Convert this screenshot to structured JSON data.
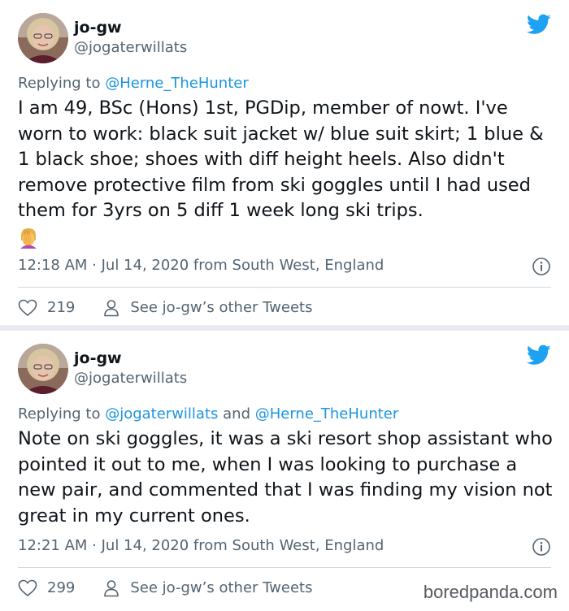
{
  "colors": {
    "link": "#1b95e0",
    "muted": "#536471",
    "text": "#0f1419",
    "twitter_blue": "#1da1f2"
  },
  "tweets": [
    {
      "display_name": "jo-gw",
      "handle": "@jogaterwillats",
      "replying_prefix": "Replying to ",
      "mentions": [
        "@Herne_TheHunter"
      ],
      "mention_joiner": "",
      "body": "I am 49, BSc (Hons) 1st, PGDip, member of nowt. I've worn to work: black suit jacket w/ blue suit skirt; 1 blue & 1 black shoe; shoes with diff height heels. Also didn't remove protective film from ski goggles until I had used them for 3yrs on 5 diff 1 week long ski trips.",
      "emoji": "face-palm-emoji",
      "timestamp": "12:18 AM · Jul 14, 2020 from South West, England",
      "likes": "219",
      "other_tweets_label": "See jo-gw’s other Tweets"
    },
    {
      "display_name": "jo-gw",
      "handle": "@jogaterwillats",
      "replying_prefix": "Replying to ",
      "mentions": [
        "@jogaterwillats",
        "@Herne_TheHunter"
      ],
      "mention_joiner": " and ",
      "body": "Note on ski goggles, it was a ski resort shop assistant who pointed it out to me, when I was looking to purchase a new pair, and commented that I was finding my vision not great in my current ones.",
      "timestamp": "12:21 AM · Jul 14, 2020 from South West, England",
      "likes": "299",
      "other_tweets_label": "See jo-gw’s other Tweets"
    }
  ],
  "watermark": "boredpanda.com"
}
